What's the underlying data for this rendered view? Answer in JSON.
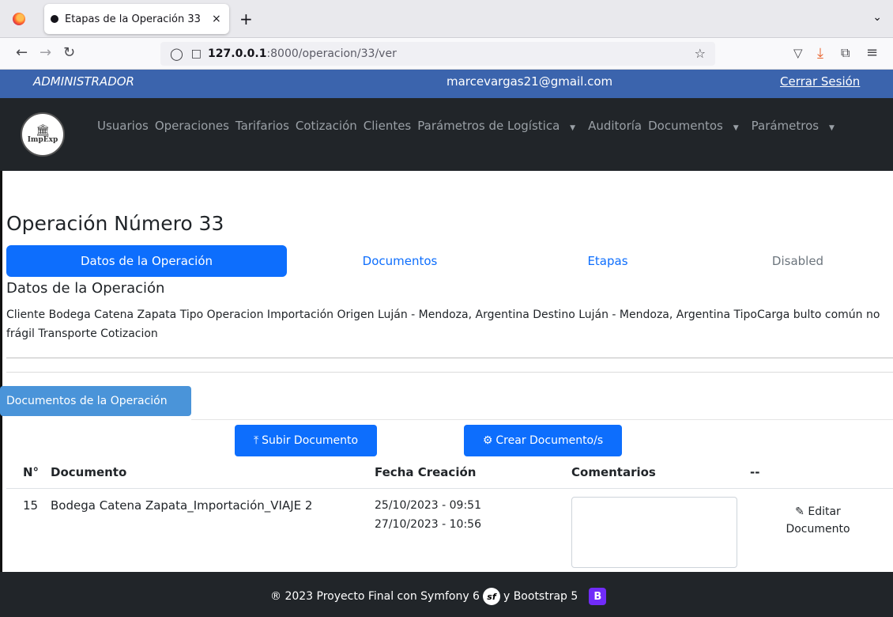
{
  "browser": {
    "tab_title": "Etapas de la Operación 33",
    "tab_close": "×",
    "new_tab": "+",
    "url_host": "127.0.0.1",
    "url_path": ":8000/operacion/33/ver"
  },
  "header": {
    "role": "ADMINISTRADOR",
    "email": "marcevargas21@gmail.com",
    "logout": "Cerrar Sesión"
  },
  "logo": {
    "text": "ImpExp"
  },
  "menu": {
    "usuarios": "Usuarios",
    "operaciones": "Operaciones",
    "tarifarios": "Tarifarios",
    "cotizacion": "Cotización",
    "clientes": "Clientes",
    "logistica": "Parámetros de Logística",
    "auditoria": "Auditoría",
    "documentos": "Documentos",
    "parametros": "Parámetros"
  },
  "page": {
    "title": "Operación Número 33",
    "tabs": [
      {
        "label": "Datos de la Operación"
      },
      {
        "label": "Documentos"
      },
      {
        "label": "Etapas"
      },
      {
        "label": "Disabled"
      }
    ],
    "section_title": "Datos de la Operación",
    "details": "Cliente Bodega Catena Zapata Tipo Operacion Importación Origen Luján - Mendoza, Argentina Destino Luján - Mendoza, Argentina TipoCarga bulto común no frágil Transporte Cotizacion"
  },
  "documents": {
    "card_title": "Documentos de la Operación",
    "upload_label": "Subir Documento",
    "create_label": "Crear Documento/s",
    "columns": {
      "num": "N°",
      "doc": "Documento",
      "date": "Fecha Creación",
      "comments": "Comentarios",
      "actions": "--"
    },
    "rows": [
      {
        "num": "15",
        "name": "Bodega Catena Zapata_Importación_VIAJE 2",
        "date1": "25/10/2023 - 09:51",
        "date2": "27/10/2023 - 10:56",
        "edit_line1": "Editar",
        "edit_line2": "Documento"
      }
    ]
  },
  "footer": {
    "text_before": "® 2023 Proyecto Final con Symfony 6",
    "text_after": "y Bootstrap 5",
    "symfony_logo": "sf",
    "bootstrap_logo": "B"
  },
  "colors": {
    "primary": "#0d6efd",
    "header_blue": "#3b64ad",
    "dark": "#212529",
    "card_header": "#4a94d9"
  }
}
